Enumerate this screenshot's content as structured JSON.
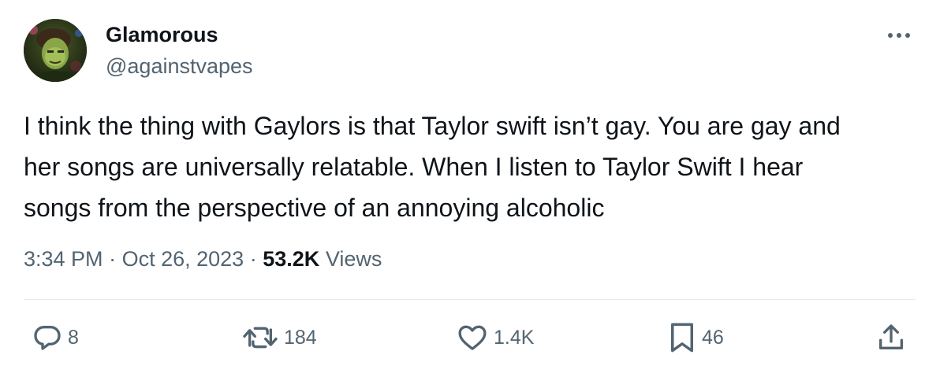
{
  "author": {
    "display_name": "Glamorous",
    "handle": "@againstvapes"
  },
  "tweet": {
    "text": "I think the thing with Gaylors is that Taylor swift isn’t gay. You are gay and\nher songs are universally relatable. When I listen to Taylor Swift I hear\nsongs from the perspective of an annoying alcoholic"
  },
  "meta": {
    "time": "3:34 PM",
    "separator": "·",
    "date": "Oct 26, 2023",
    "views_count": "53.2K",
    "views_label": "Views"
  },
  "actions": {
    "replies": "8",
    "retweets": "184",
    "likes": "1.4K",
    "bookmarks": "46"
  },
  "icons": {
    "more": "more-dots-icon",
    "reply": "reply-bubble-icon",
    "retweet": "retweet-icon",
    "like": "heart-icon",
    "bookmark": "bookmark-icon",
    "share": "share-icon"
  },
  "colors": {
    "text_primary": "#0f1419",
    "text_secondary": "#536471",
    "divider": "#e6ebee",
    "background": "#ffffff"
  }
}
